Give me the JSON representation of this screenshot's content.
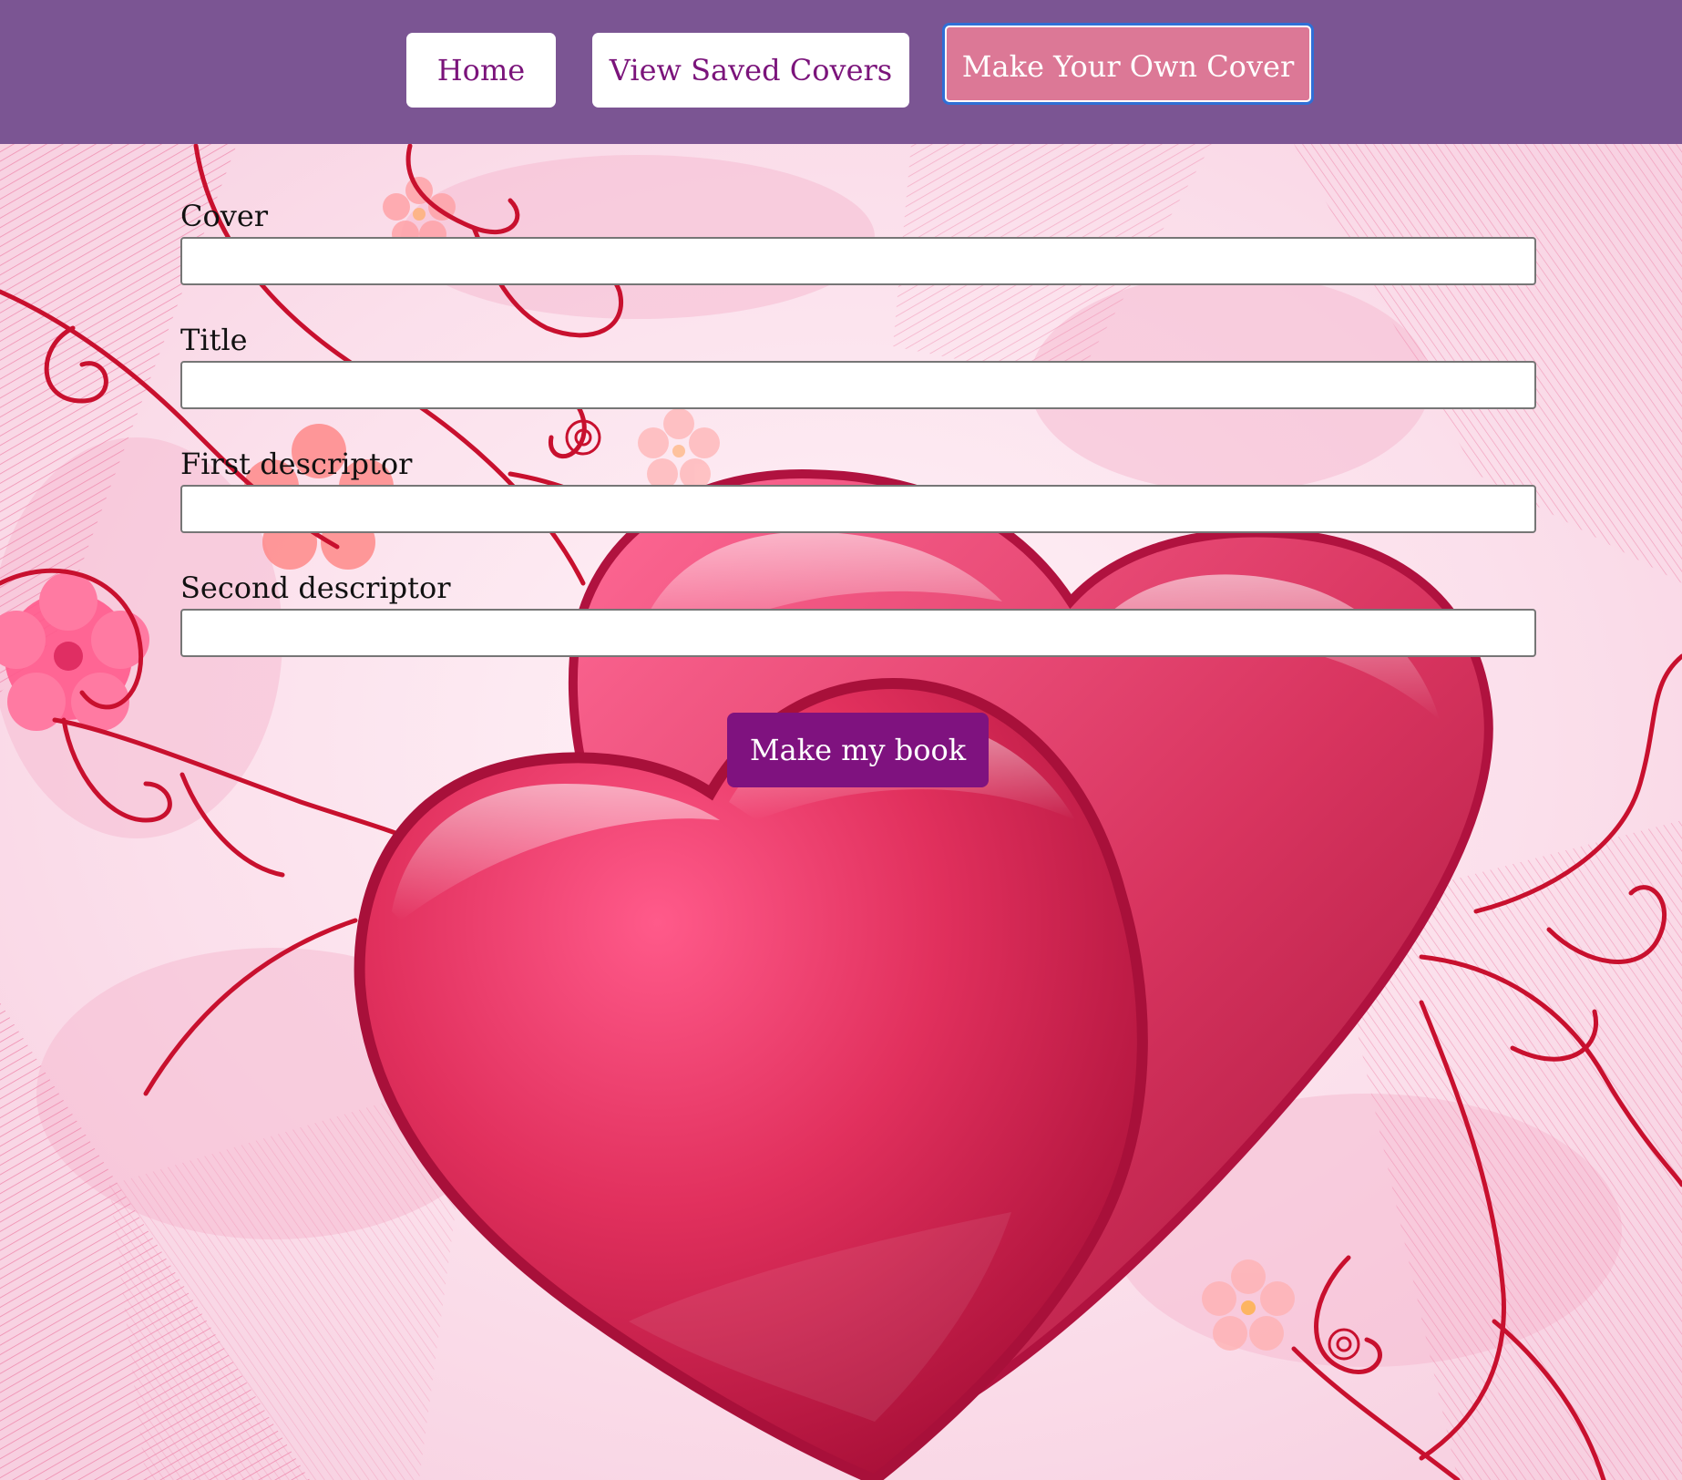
{
  "nav": {
    "home_label": "Home",
    "saved_label": "View Saved Covers",
    "make_label": "Make Your Own Cover"
  },
  "form": {
    "cover_label": "Cover",
    "cover_value": "",
    "title_label": "Title",
    "title_value": "",
    "first_label": "First descriptor",
    "first_value": "",
    "second_label": "Second descriptor",
    "second_value": "",
    "submit_label": "Make my book"
  },
  "colors": {
    "header_bg": "#7b5593",
    "nav_text": "#7b147b",
    "active_nav_bg": "#dc7896",
    "submit_bg": "#7f127f",
    "heart_red": "#e0345f"
  },
  "background": {
    "icon": "two-hearts-background"
  }
}
